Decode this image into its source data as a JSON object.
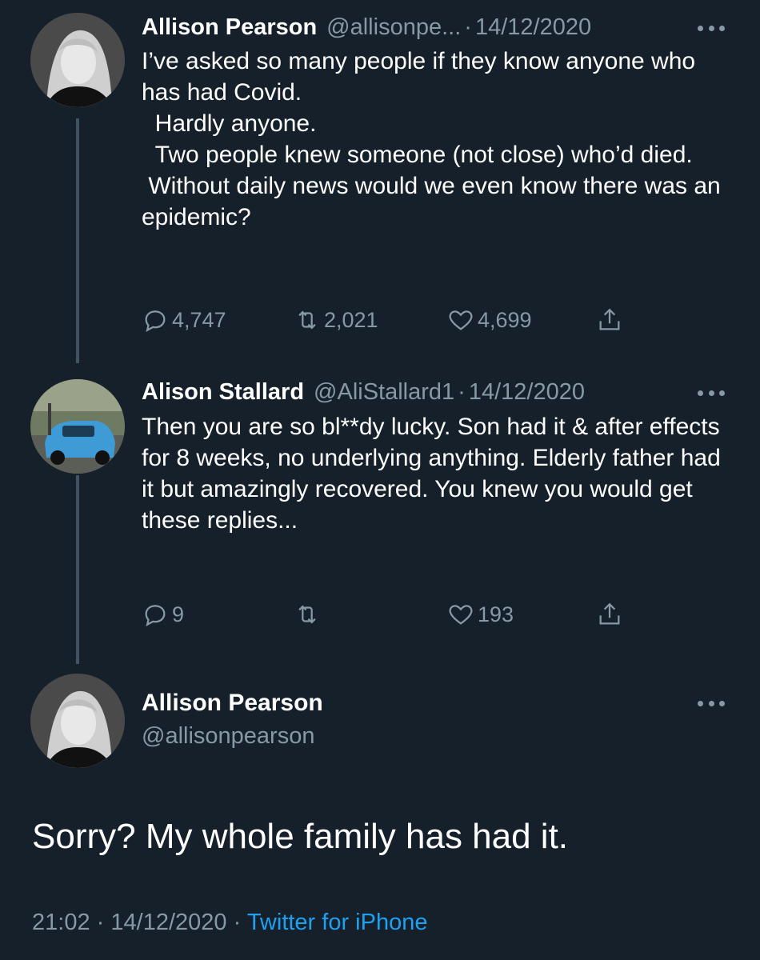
{
  "thread": [
    {
      "author_name": "Allison Pearson",
      "author_handle": "@allisonpe...",
      "separator": "·",
      "date": "14/12/2020",
      "text": "I’ve asked so many people if they know anyone who has had Covid.\n  Hardly anyone.\n  Two people knew someone (not close) who’d died.\n Without daily news would we even know there was an epidemic?",
      "replies": "4,747",
      "retweets": "2,021",
      "likes": "4,699"
    },
    {
      "author_name": "Alison Stallard",
      "author_handle": "@AliStallard1",
      "separator": "·",
      "date": "14/12/2020",
      "text": "Then you are so bl**dy lucky. Son had it & after effects for 8 weeks, no underlying anything. Elderly father had it but amazingly recovered. You knew you would get these replies...",
      "replies": "9",
      "retweets": "",
      "likes": "193"
    }
  ],
  "main_tweet": {
    "author_name": "Allison Pearson",
    "author_handle": "@allisonpearson",
    "text": "Sorry? My whole family has had it.",
    "time": "21:02",
    "separator1": "·",
    "date": "14/12/2020",
    "separator2": "·",
    "source": "Twitter for iPhone"
  },
  "icons": {
    "reply": "reply-icon",
    "retweet": "retweet-icon",
    "like": "heart-icon",
    "share": "share-icon",
    "more": "more-icon"
  },
  "colors": {
    "background": "#15202b",
    "secondary_text": "#8899a6",
    "link": "#1da1f2",
    "thread_line": "#3d5466"
  }
}
